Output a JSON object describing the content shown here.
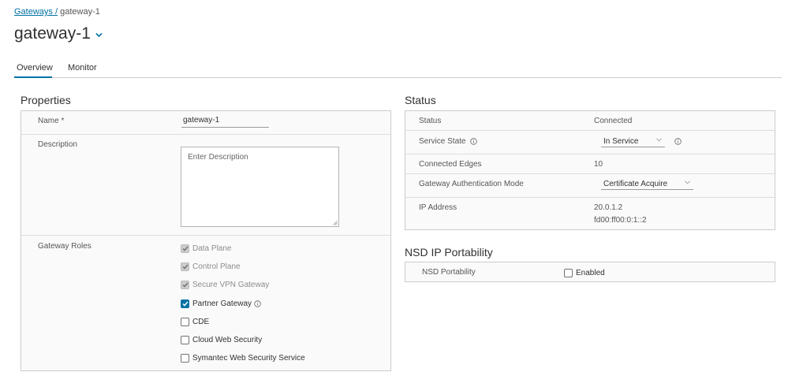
{
  "breadcrumb": {
    "parent": "Gateways /",
    "current": "gateway-1"
  },
  "page": {
    "title": "gateway-1"
  },
  "tabs": [
    {
      "label": "Overview",
      "active": true
    },
    {
      "label": "Monitor",
      "active": false
    }
  ],
  "properties": {
    "title": "Properties",
    "name_label": "Name *",
    "name_value": "gateway-1",
    "description_label": "Description",
    "description_placeholder": "Enter Description",
    "roles_label": "Gateway Roles",
    "roles": [
      {
        "label": "Data Plane",
        "checked": true,
        "disabled": true
      },
      {
        "label": "Control Plane",
        "checked": true,
        "disabled": true
      },
      {
        "label": "Secure VPN Gateway",
        "checked": true,
        "disabled": true
      },
      {
        "label": "Partner Gateway",
        "checked": true,
        "disabled": false
      },
      {
        "label": "CDE",
        "checked": false,
        "disabled": false
      },
      {
        "label": "Cloud Web Security",
        "checked": false,
        "disabled": false
      },
      {
        "label": "Symantec Web Security Service",
        "checked": false,
        "disabled": false
      }
    ]
  },
  "status": {
    "title": "Status",
    "status_label": "Status",
    "status_value": "Connected",
    "service_state_label": "Service State",
    "service_state_value": "In Service",
    "connected_edges_label": "Connected Edges",
    "connected_edges_value": "10",
    "auth_mode_label": "Gateway Authentication Mode",
    "auth_mode_value": "Certificate Acquire",
    "ip_label": "IP Address",
    "ipv4": "20.0.1.2",
    "ipv6": "fd00:ff00:0:1::2"
  },
  "nsd": {
    "title": "NSD IP Portability",
    "label": "NSD Portability",
    "checkbox_label": "Enabled",
    "enabled": false
  },
  "colors": {
    "accent": "#0072a3",
    "border": "#cccccc",
    "panel_bg": "#fafafa"
  }
}
